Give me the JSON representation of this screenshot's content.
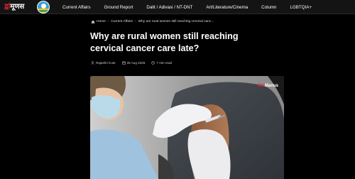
{
  "header": {
    "logo_text_red": "द्वां",
    "logo_text_white": "मूणस",
    "nav": [
      {
        "label": "Current Affairs"
      },
      {
        "label": "Ground Report"
      },
      {
        "label": "Dalit / Adivasi / NT-DNT"
      },
      {
        "label": "Art/Literature/Cinema"
      },
      {
        "label": "Column"
      },
      {
        "label": "LGBTQIA+"
      }
    ]
  },
  "breadcrumb": {
    "home": "Home",
    "category": "Current Affairs",
    "current": "Why are rural women still reaching cervical canc..."
  },
  "article": {
    "title": "Why are rural women still reaching cervical cancer care late?",
    "author": "Rajashri Kute",
    "date": "26 Aug 2026",
    "read_time": "7 min read"
  },
  "hero": {
    "brand_red": "Bol",
    "brand_white": "Manus"
  },
  "colors": {
    "background": "#000000",
    "nav_background": "#141414",
    "accent": "#e0262f",
    "text": "#ffffff"
  },
  "icons": [
    "home-icon",
    "user-icon",
    "calendar-icon",
    "clock-icon",
    "logo-badge-icon"
  ]
}
